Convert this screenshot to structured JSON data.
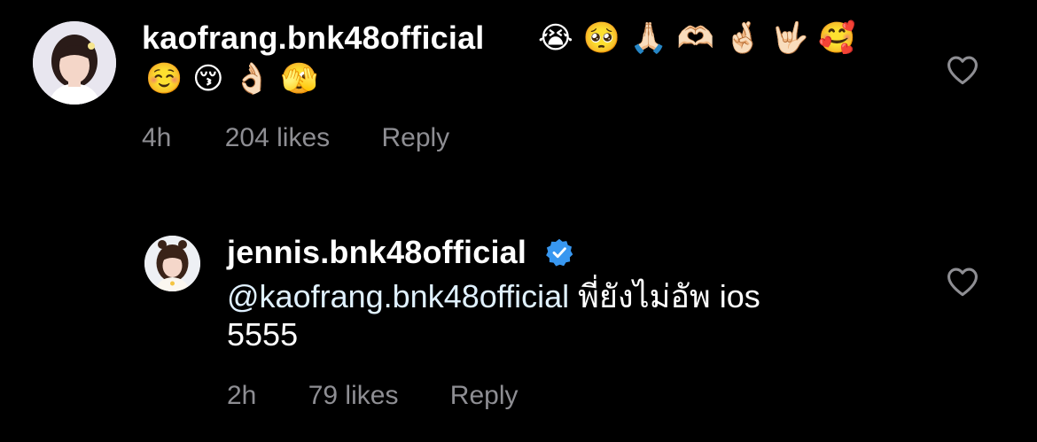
{
  "comments": [
    {
      "username": "kaofrang.bnk48official",
      "emojis_line1": "😭 🥺 🙏🏻 🫶🏻 🤞🏻 🤟🏻 🥰",
      "emojis_line2": "☺️ 😚 👌🏻 🫣",
      "time": "4h",
      "likes": "204 likes",
      "reply_label": "Reply"
    },
    {
      "username": "jennis.bnk48official",
      "mention": "@kaofrang.bnk48official",
      "text_line1": " พี่ยังไม่อัพ ios",
      "text_line2": "5555",
      "time": "2h",
      "likes": "79 likes",
      "reply_label": "Reply"
    }
  ],
  "colors": {
    "background": "#000000",
    "text": "#ffffff",
    "meta": "#8e8e93",
    "verified": "#3897f0"
  },
  "icons": [
    "heart-icon",
    "verified-badge-icon"
  ]
}
